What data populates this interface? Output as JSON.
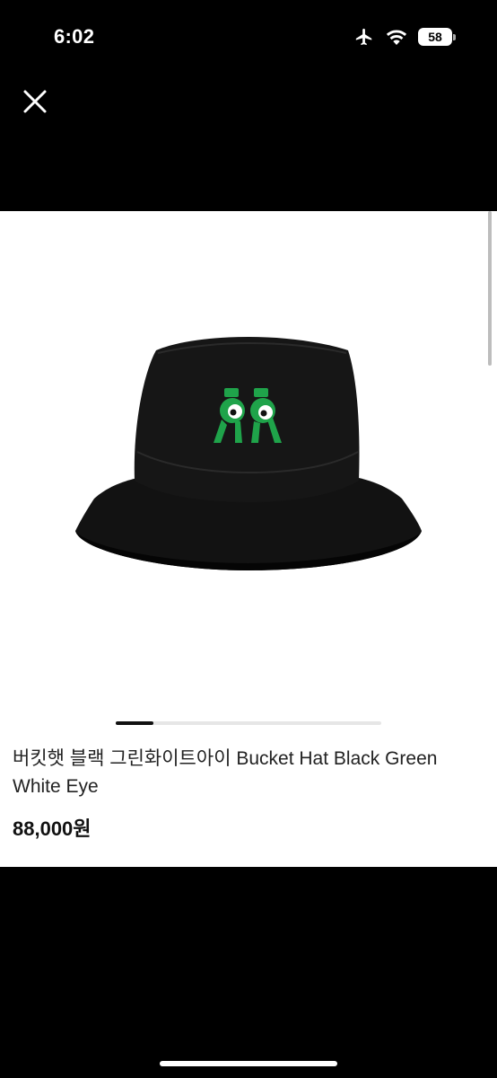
{
  "status_bar": {
    "time": "6:02",
    "icons": [
      "airplane-icon",
      "wifi-icon",
      "battery-icon"
    ],
    "battery_level": "58"
  },
  "header": {
    "close_icon": "close-icon"
  },
  "product": {
    "image_icon": "bucket-hat-image",
    "title": "버킷햇 블랙 그린화이트아이 Bucket Hat Black Green White Eye",
    "price": "88,000원",
    "gallery": {
      "total_pages": 7,
      "current_page": 1
    }
  },
  "colors": {
    "background": "#000000",
    "card": "#ffffff",
    "hat": "#151515",
    "logo_green": "#1fa34a",
    "text": "#222222"
  }
}
